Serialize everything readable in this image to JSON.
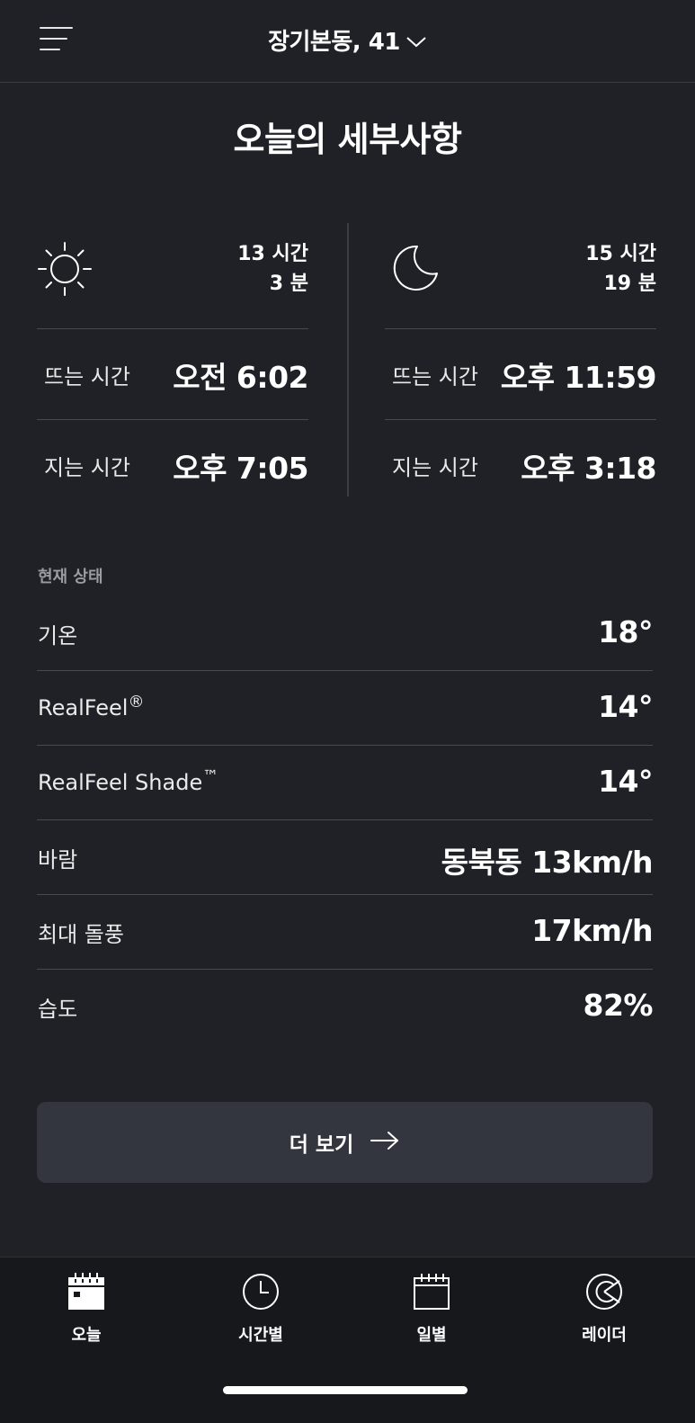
{
  "header": {
    "location": "장기본동, 41"
  },
  "title": "오늘의 세부사항",
  "sun": {
    "icon": "sun-icon",
    "duration_hours": "13 시간",
    "duration_minutes": "3 분",
    "rise_label": "뜨는 시간",
    "rise_time": "오전 6:02",
    "set_label": "지는 시간",
    "set_time": "오후 7:05"
  },
  "moon": {
    "icon": "crescent-moon-icon",
    "duration_hours": "15 시간",
    "duration_minutes": "19 분",
    "rise_label": "뜨는 시간",
    "rise_time": "오후 11:59",
    "set_label": "지는 시간",
    "set_time": "오후 3:18"
  },
  "current": {
    "section_label": "현재 상태",
    "rows": [
      {
        "label": "기온",
        "value": "18°"
      },
      {
        "label": "RealFeel",
        "sup": "®",
        "value": "14°"
      },
      {
        "label": "RealFeel Shade",
        "sup": "™",
        "value": "14°"
      },
      {
        "label": "바람",
        "value": "동북동 13km/h"
      },
      {
        "label": "최대 돌풍",
        "value": "17km/h"
      },
      {
        "label": "습도",
        "value": "82%"
      }
    ]
  },
  "more_button": {
    "label": "더 보기",
    "icon": "arrow-right-icon"
  },
  "nav": [
    {
      "label": "오늘",
      "icon": "calendar-today-icon"
    },
    {
      "label": "시간별",
      "icon": "clock-icon"
    },
    {
      "label": "일별",
      "icon": "calendar-icon"
    },
    {
      "label": "레이더",
      "icon": "radar-icon"
    }
  ],
  "colors": {
    "background": "#1f2126",
    "nav_background": "#16181c",
    "button": "#33363e",
    "divider": "#474a52",
    "muted_text": "#9a9ca2"
  }
}
